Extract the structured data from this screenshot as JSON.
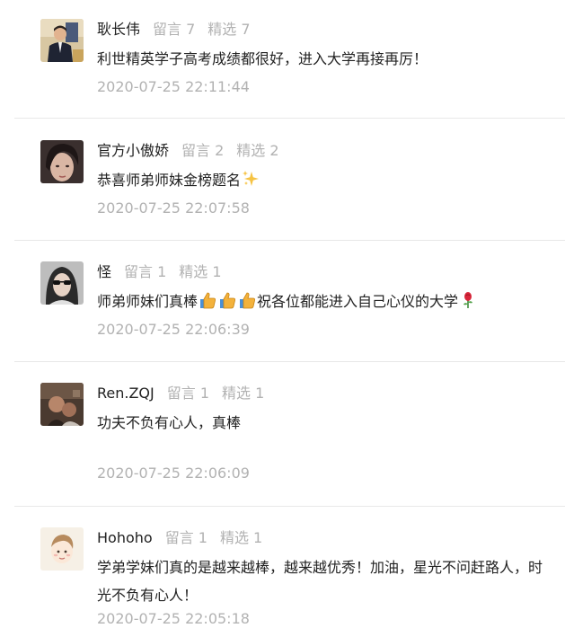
{
  "comments": [
    {
      "nickname": "耿长伟",
      "messages_label": "留言 7",
      "featured_label": "精选 7",
      "text": "利世精英学子高考成绩都很好，进入大学再接再厉！",
      "time": "2020-07-25 22:11:44",
      "avatar_icon": "avatar-suit-man"
    },
    {
      "nickname": "官方小傲娇",
      "messages_label": "留言 2",
      "featured_label": "精选 2",
      "text": "恭喜师弟师妹金榜题名",
      "time": "2020-07-25 22:07:58",
      "avatar_icon": "avatar-dark-hair"
    },
    {
      "nickname": "怪",
      "messages_label": "留言 1",
      "featured_label": "精选 1",
      "text_part1": "师弟师妹们真棒",
      "text_part2": "祝各位都能进入自己心仪的大学",
      "time": "2020-07-25 22:06:39",
      "avatar_icon": "avatar-sunglasses"
    },
    {
      "nickname": "Ren.ZQJ",
      "messages_label": "留言 1",
      "featured_label": "精选 1",
      "text": "功夫不负有心人，真棒",
      "time": "2020-07-25 22:06:09",
      "avatar_icon": "avatar-dim-photo"
    },
    {
      "nickname": "Hohoho",
      "messages_label": "留言 1",
      "featured_label": "精选 1",
      "text": "学弟学妹们真的是越来越棒，越来越优秀！加油，星光不问赶路人，时光不负有心人！",
      "time": "2020-07-25 22:05:18",
      "avatar_icon": "avatar-cartoon"
    }
  ],
  "emoji": [
    "sparkles-emoji",
    "thumbs-up-emoji",
    "rose-emoji"
  ],
  "colors": {
    "nickname": "#222222",
    "muted": "#b2b2b2",
    "divider": "#e8e8e8"
  }
}
